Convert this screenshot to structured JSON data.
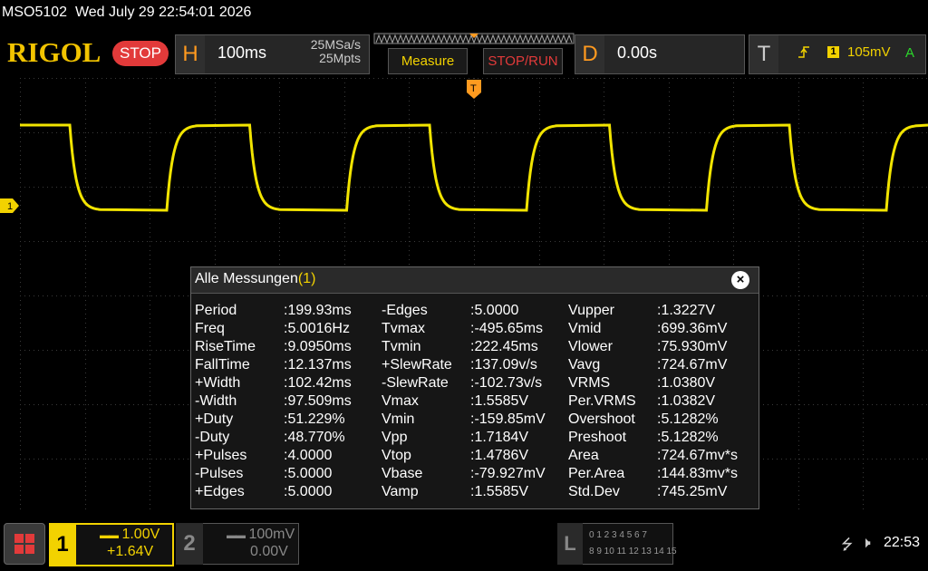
{
  "header": {
    "model": "MSO5102",
    "datetime": "Wed July 29 22:54:01 2026",
    "logo": "RIGOL",
    "run_state": "STOP"
  },
  "horizontal": {
    "letter": "H",
    "timebase": "100ms",
    "sample_rate": "25MSa/s",
    "memory_depth": "25Mpts"
  },
  "buttons": {
    "measure": "Measure",
    "stop_run": "STOP/RUN"
  },
  "delay": {
    "letter": "D",
    "value": "0.00s"
  },
  "trigger": {
    "letter": "T",
    "edge_icon": "rising-edge-icon",
    "source": "1",
    "level": "105mV",
    "mode": "A"
  },
  "markers": {
    "channel1": "1",
    "trigger": "T"
  },
  "measurements": {
    "title": "Alle Messungen",
    "title_channel": "(1)",
    "close": "×",
    "columns": [
      [
        {
          "name": "Period",
          "value": ":199.93ms"
        },
        {
          "name": "Freq",
          "value": ":5.0016Hz"
        },
        {
          "name": "RiseTime",
          "value": ":9.0950ms"
        },
        {
          "name": "FallTime",
          "value": ":12.137ms"
        },
        {
          "name": "+Width",
          "value": ":102.42ms"
        },
        {
          "name": "-Width",
          "value": ":97.509ms"
        },
        {
          "name": "+Duty",
          "value": ":51.229%"
        },
        {
          "name": "-Duty",
          "value": ":48.770%"
        },
        {
          "name": "+Pulses",
          "value": ":4.0000"
        },
        {
          "name": "-Pulses",
          "value": ":5.0000"
        },
        {
          "name": "+Edges",
          "value": ":5.0000"
        }
      ],
      [
        {
          "name": "-Edges",
          "value": ":5.0000"
        },
        {
          "name": "Tvmax",
          "value": ":-495.65ms"
        },
        {
          "name": "Tvmin",
          "value": ":222.45ms"
        },
        {
          "name": "+SlewRate",
          "value": ":137.09v/s"
        },
        {
          "name": "-SlewRate",
          "value": ":-102.73v/s"
        },
        {
          "name": "Vmax",
          "value": ":1.5585V"
        },
        {
          "name": "Vmin",
          "value": ":-159.85mV"
        },
        {
          "name": "Vpp",
          "value": ":1.7184V"
        },
        {
          "name": "Vtop",
          "value": ":1.4786V"
        },
        {
          "name": "Vbase",
          "value": ":-79.927mV"
        },
        {
          "name": "Vamp",
          "value": ":1.5585V"
        }
      ],
      [
        {
          "name": "Vupper",
          "value": ":1.3227V"
        },
        {
          "name": "Vmid",
          "value": ":699.36mV"
        },
        {
          "name": "Vlower",
          "value": ":75.930mV"
        },
        {
          "name": "Vavg",
          "value": ":724.67mV"
        },
        {
          "name": "VRMS",
          "value": ":1.0380V"
        },
        {
          "name": "Per.VRMS",
          "value": ":1.0382V"
        },
        {
          "name": "Overshoot",
          "value": ":5.1282%"
        },
        {
          "name": "Preshoot",
          "value": ":5.1282%"
        },
        {
          "name": "Area",
          "value": ":724.67mv*s"
        },
        {
          "name": "Per.Area",
          "value": ":144.83mv*s"
        },
        {
          "name": "Std.Dev",
          "value": ":745.25mV"
        }
      ]
    ]
  },
  "channels": {
    "ch1": {
      "number": "1",
      "scale": "1.00V",
      "offset": "+1.64V",
      "color": "#f2d200"
    },
    "ch2": {
      "number": "2",
      "scale": "100mV",
      "offset": "0.00V",
      "color": "#888888"
    }
  },
  "logic": {
    "letter": "L",
    "row1": "0 1 2 3  4 5 6 7",
    "row2": "8 9 10 11 12 13 14 15"
  },
  "status": {
    "usb_icon": "usb-icon",
    "speaker_icon": "speaker-muted-icon",
    "time": "22:53"
  }
}
